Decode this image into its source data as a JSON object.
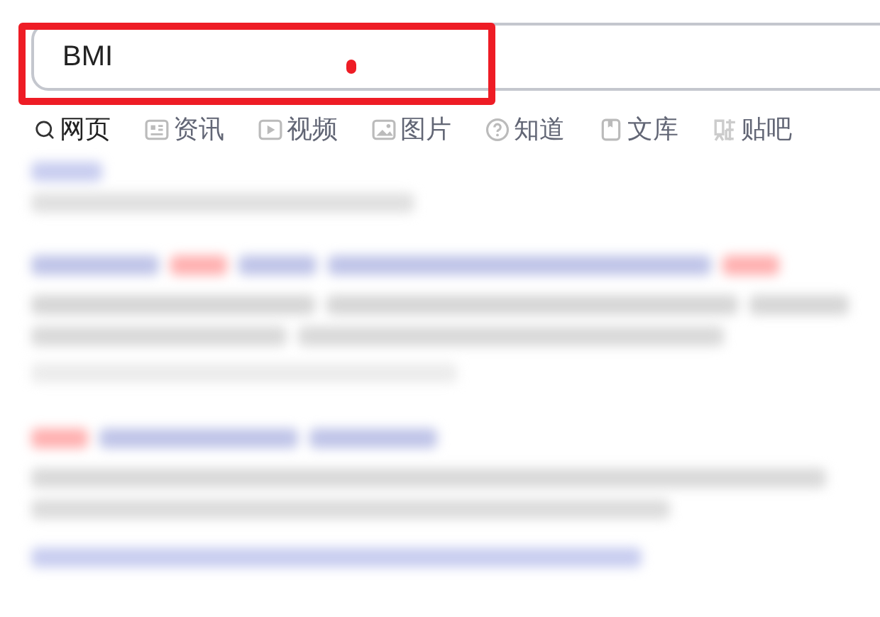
{
  "search": {
    "value": "BMI",
    "highlighted": true
  },
  "tabs": [
    {
      "label": "网页",
      "kind": "search",
      "selected": true
    },
    {
      "label": "资讯",
      "kind": "news",
      "selected": false
    },
    {
      "label": "视频",
      "kind": "video",
      "selected": false
    },
    {
      "label": "图片",
      "kind": "image",
      "selected": false
    },
    {
      "label": "知道",
      "kind": "question",
      "selected": false
    },
    {
      "label": "文库",
      "kind": "doc",
      "selected": false
    },
    {
      "label": "贴吧",
      "kind": "tieba",
      "selected": false
    }
  ]
}
